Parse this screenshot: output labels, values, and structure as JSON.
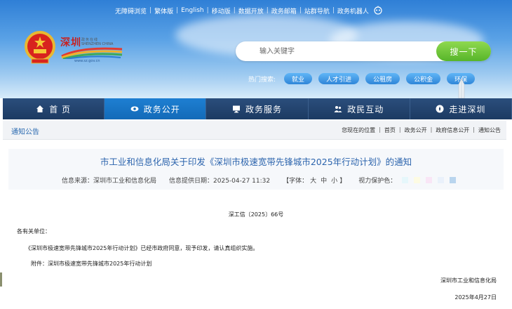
{
  "top_links": [
    "无障碍浏览",
    "繁体版",
    "English",
    "移动版",
    "数据开放",
    "政务邮箱",
    "站群导航",
    "政务机器人"
  ],
  "logo": {
    "title": "深圳",
    "subtitle": "政务在线",
    "subtitle_en": "SHENZHEN CHINA",
    "url": "www.sz.gov.cn"
  },
  "search": {
    "placeholder": "输入关键字",
    "button": "搜一下"
  },
  "hot_search": {
    "label": "热门搜索:",
    "tags": [
      "就业",
      "人才引进",
      "公租房",
      "公积金",
      "环保"
    ]
  },
  "nav": [
    {
      "label": "首 页",
      "icon": "home-icon",
      "active": false
    },
    {
      "label": "政务公开",
      "icon": "eye-icon",
      "active": true
    },
    {
      "label": "政务服务",
      "icon": "monitor-icon",
      "active": false
    },
    {
      "label": "政民互动",
      "icon": "people-icon",
      "active": false
    },
    {
      "label": "走进深圳",
      "icon": "compass-icon",
      "active": false
    }
  ],
  "breadcrumb": {
    "section": "通知公告",
    "items": [
      "您现在的位置",
      "首页",
      "政务公开",
      "政府信息公开",
      "通知公告"
    ]
  },
  "article": {
    "title": "市工业和信息化局关于印发《深圳市极速宽带先锋城市2025年行动计划》的通知",
    "source": "信息来源：深圳市工业和信息化局",
    "date": "信息提供日期：2025-04-27 11:32",
    "font_label": "【字体：",
    "font_sizes": [
      "大",
      "中",
      "小"
    ],
    "font_close": "】",
    "vision_label": "视力保护色：",
    "swatches": [
      "#e6f7fb",
      "#fdfbe3",
      "#f9e6f6",
      "#eaf1fb",
      "#b9d5ee"
    ],
    "doc_number": "深工信〔2025〕66号",
    "salutation": "各有关单位：",
    "paragraph": "《深圳市极速宽带先锋城市2025年行动计划》已经市政府同意，现予印发，请认真组织实施。",
    "attachment": "附件：深圳市极速宽带先锋城市2025年行动计划",
    "signature": "深圳市工业和信息化局",
    "sign_date": "2025年4月27日"
  },
  "colors": {
    "nav_bg": "#1c3a62",
    "nav_active": "#136ab8",
    "title_blue": "#2c64ad",
    "search_green": "#57b52a"
  }
}
